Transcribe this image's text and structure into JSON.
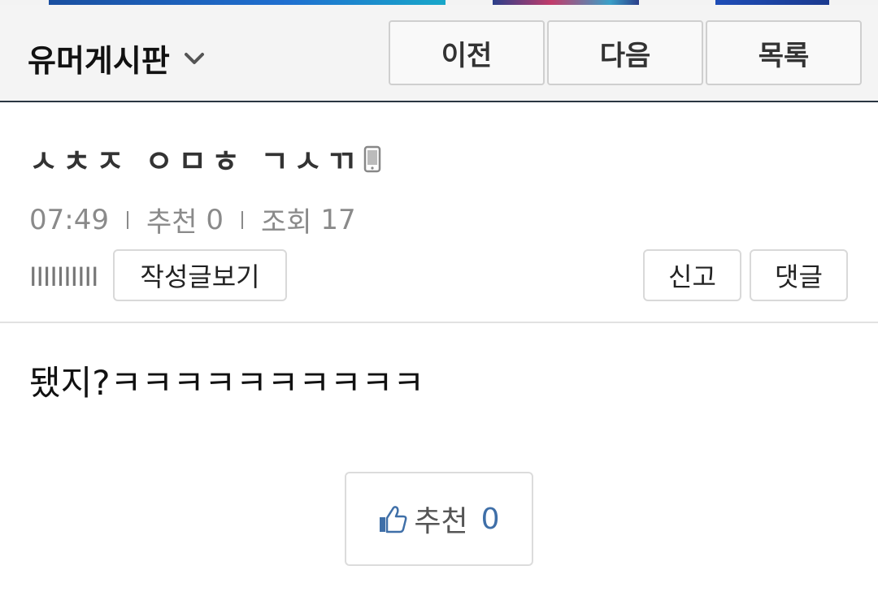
{
  "header": {
    "board_name": "유머게시판",
    "prev_label": "이전",
    "next_label": "다음",
    "list_label": "목록"
  },
  "post": {
    "title": "ㅅㅊㅈ ㅇㅁㅎ ㄱㅅㄲ",
    "time": "07:49",
    "recommend_label": "추천",
    "recommend_count": "0",
    "views_label": "조회",
    "views_count": "17",
    "author": "IIIIIIIIII",
    "view_posts_label": "작성글보기",
    "report_label": "신고",
    "comment_label": "댓글",
    "body": "됐지?ㅋㅋㅋㅋㅋㅋㅋㅋㅋㅋ"
  },
  "recommend_button": {
    "label": "추천",
    "count": "0"
  },
  "colors": {
    "accent_blue": "#3f6fa8",
    "header_border": "#2a3642"
  }
}
